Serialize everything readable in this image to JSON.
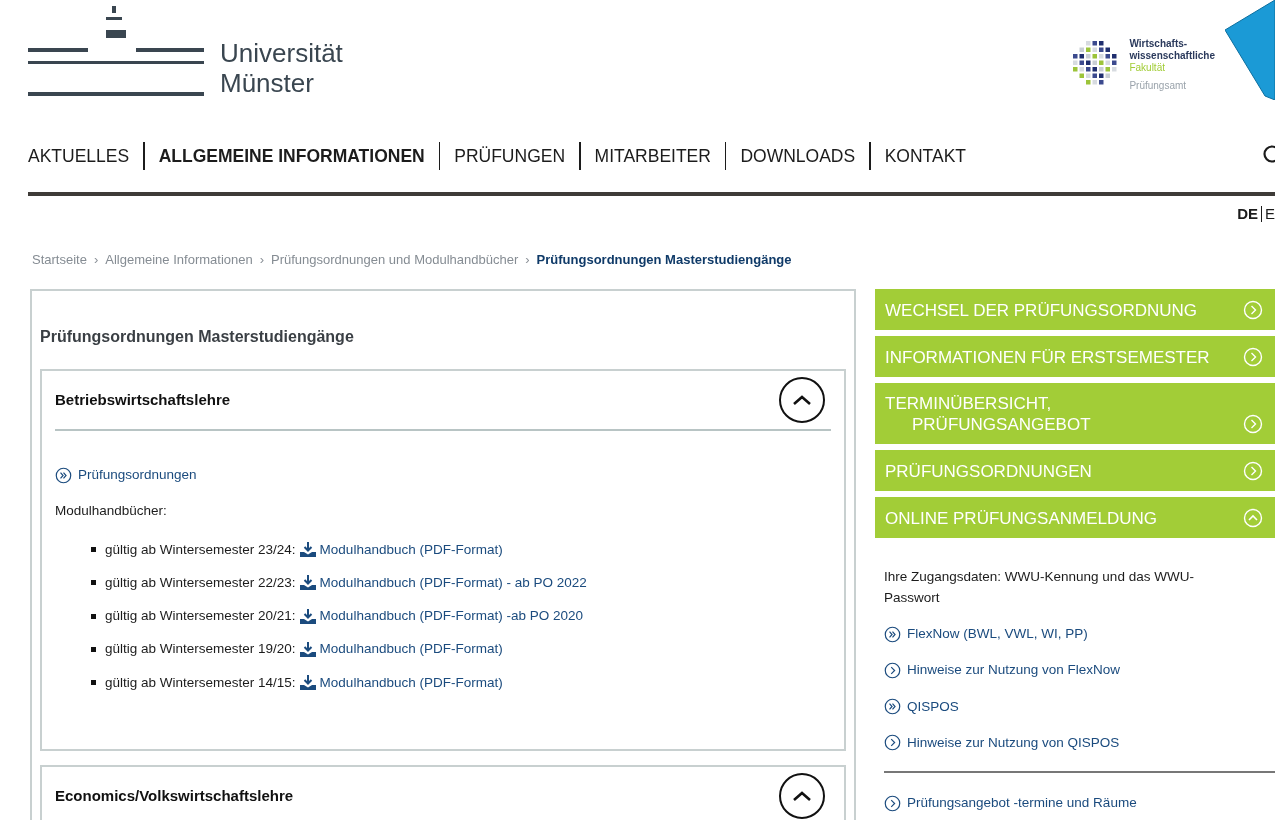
{
  "header": {
    "university_logo": {
      "lines": [
        "Universität",
        "Münster"
      ]
    },
    "faculty_logo": {
      "lines": [
        "Wirtschafts-",
        "wissenschaftliche"
      ],
      "highlight": "Fakultät",
      "subtitle": "Prüfungsamt"
    }
  },
  "nav": [
    {
      "label": "AKTUELLES",
      "selected": false
    },
    {
      "label": "ALLGEMEINE INFORMATIONEN",
      "selected": true
    },
    {
      "label": "PRÜFUNGEN",
      "selected": false
    },
    {
      "label": "MITARBEITER",
      "selected": false
    },
    {
      "label": "DOWNLOADS",
      "selected": false
    },
    {
      "label": "KONTAKT",
      "selected": false
    }
  ],
  "languages": [
    {
      "label": "DE",
      "selected": true
    },
    {
      "label": "E",
      "selected": false
    }
  ],
  "breadcrumb_separator": "›",
  "breadcrumbs": [
    {
      "label": "Startseite",
      "selected": false
    },
    {
      "label": "Allgemeine Informationen",
      "selected": false
    },
    {
      "label": "Prüfungsordnungen und Modulhandbücher",
      "selected": false
    },
    {
      "label": "Prüfungsordnungen Masterstudiengänge",
      "selected": true
    }
  ],
  "main": {
    "title": "Prüfungsordnungen Masterstudiengänge",
    "sections": [
      {
        "title": "Betriebswirtschaftslehre",
        "expanded": true,
        "links": [
          {
            "label": "Prüfungsordnungen",
            "kind": "double"
          }
        ],
        "subheading": "Modulhandbücher:",
        "items": [
          {
            "text": "gültig ab Wintersemester 23/24:",
            "link": "Modulhandbuch (PDF-Format)"
          },
          {
            "text": "gültig ab Wintersemester 22/23:",
            "link": "Modulhandbuch (PDF-Format) - ab PO 2022"
          },
          {
            "text": "gültig ab Wintersemester 20/21:",
            "link": "Modulhandbuch (PDF-Format) -ab PO 2020"
          },
          {
            "text": "gültig ab Wintersemester 19/20:",
            "link": "Modulhandbuch (PDF-Format)"
          },
          {
            "text": "gültig ab Wintersemester 14/15:",
            "link": "Modulhandbuch (PDF-Format)"
          }
        ]
      },
      {
        "title": "Economics/Volkswirtschaftslehre",
        "expanded": true
      }
    ]
  },
  "sidebar": {
    "menu": [
      {
        "label": "WECHSEL DER PRÜFUNGSORDNUNG",
        "expanded": false
      },
      {
        "label": "INFORMATIONEN FÜR ERSTSEMESTER",
        "expanded": false
      },
      {
        "label": "TERMINÜBERSICHT, PRÜFUNGSANGEBOT",
        "expanded": false
      },
      {
        "label": "PRÜFUNGSORDNUNGEN",
        "expanded": false
      },
      {
        "label": "ONLINE PRÜFUNGSANMELDUNG",
        "expanded": true
      }
    ],
    "panel": {
      "text": "Ihre Zugangsdaten: WWU-Kennung und das WWU-Passwort",
      "links": [
        {
          "label": "FlexNow (BWL, VWL, WI, PP)",
          "kind": "double"
        },
        {
          "label": "Hinweise zur Nutzung von FlexNow",
          "kind": "single"
        },
        {
          "label": "QISPOS",
          "kind": "double"
        },
        {
          "label": "Hinweise zur Nutzung von QISPOS",
          "kind": "single"
        }
      ]
    },
    "links_below": [
      {
        "label": "Prüfungsangebot -termine und Räume",
        "kind": "single"
      }
    ]
  }
}
